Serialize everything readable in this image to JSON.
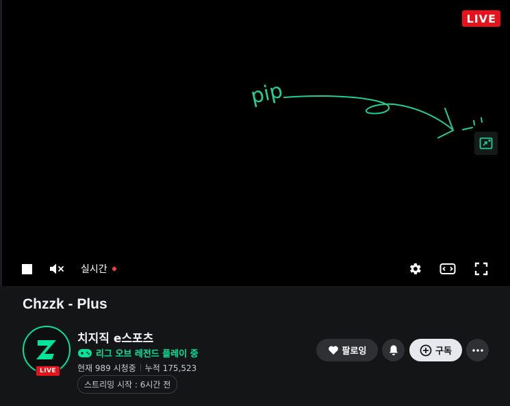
{
  "player": {
    "live_badge": "LIVE",
    "annotation_text": "pip",
    "realtime_label": "실시간"
  },
  "stream": {
    "title": "Chzzk - Plus"
  },
  "channel": {
    "name": "치지직 e스포츠",
    "avatar_live": "LIVE",
    "game": "리그 오브 레전드 플레이 중",
    "viewers_now": "현재 989 시청중",
    "viewers_total": "누적 175,523",
    "stream_start": "스트리밍 시작 : 6시간 전"
  },
  "actions": {
    "follow_label": "팔로잉",
    "subscribe_label": "구독"
  },
  "colors": {
    "accent": "#00e59a",
    "live_red": "#e8121b",
    "background": "#141517"
  },
  "icons": [
    "stop-icon",
    "mute-icon",
    "settings-icon",
    "theater-icon",
    "fullscreen-icon",
    "pip-icon",
    "gamepad-icon",
    "heart-icon",
    "bell-icon",
    "plus-circle-icon",
    "more-icon"
  ]
}
